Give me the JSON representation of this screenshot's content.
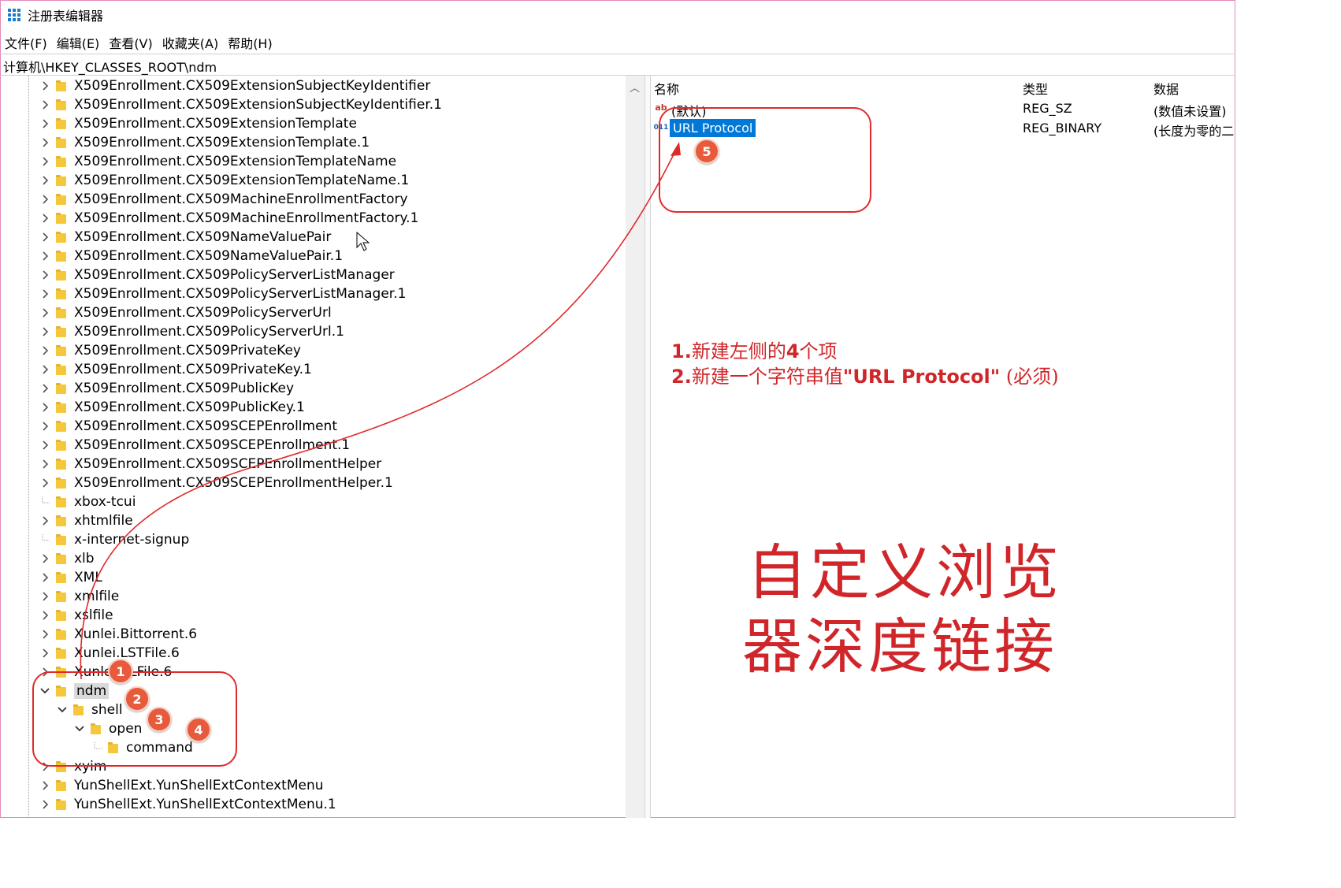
{
  "window": {
    "title": "注册表编辑器"
  },
  "menu": [
    "文件(F)",
    "编辑(E)",
    "查看(V)",
    "收藏夹(A)",
    "帮助(H)"
  ],
  "address": "计算机\\HKEY_CLASSES_ROOT\\ndm",
  "tree": {
    "items": [
      {
        "label": "X509Enrollment.CX509ExtensionSubjectKeyIdentifier",
        "expander": "collapsed"
      },
      {
        "label": "X509Enrollment.CX509ExtensionSubjectKeyIdentifier.1",
        "expander": "collapsed"
      },
      {
        "label": "X509Enrollment.CX509ExtensionTemplate",
        "expander": "collapsed"
      },
      {
        "label": "X509Enrollment.CX509ExtensionTemplate.1",
        "expander": "collapsed"
      },
      {
        "label": "X509Enrollment.CX509ExtensionTemplateName",
        "expander": "collapsed"
      },
      {
        "label": "X509Enrollment.CX509ExtensionTemplateName.1",
        "expander": "collapsed"
      },
      {
        "label": "X509Enrollment.CX509MachineEnrollmentFactory",
        "expander": "collapsed"
      },
      {
        "label": "X509Enrollment.CX509MachineEnrollmentFactory.1",
        "expander": "collapsed"
      },
      {
        "label": "X509Enrollment.CX509NameValuePair",
        "expander": "collapsed"
      },
      {
        "label": "X509Enrollment.CX509NameValuePair.1",
        "expander": "collapsed"
      },
      {
        "label": "X509Enrollment.CX509PolicyServerListManager",
        "expander": "collapsed"
      },
      {
        "label": "X509Enrollment.CX509PolicyServerListManager.1",
        "expander": "collapsed"
      },
      {
        "label": "X509Enrollment.CX509PolicyServerUrl",
        "expander": "collapsed"
      },
      {
        "label": "X509Enrollment.CX509PolicyServerUrl.1",
        "expander": "collapsed"
      },
      {
        "label": "X509Enrollment.CX509PrivateKey",
        "expander": "collapsed"
      },
      {
        "label": "X509Enrollment.CX509PrivateKey.1",
        "expander": "collapsed"
      },
      {
        "label": "X509Enrollment.CX509PublicKey",
        "expander": "collapsed"
      },
      {
        "label": "X509Enrollment.CX509PublicKey.1",
        "expander": "collapsed"
      },
      {
        "label": "X509Enrollment.CX509SCEPEnrollment",
        "expander": "collapsed"
      },
      {
        "label": "X509Enrollment.CX509SCEPEnrollment.1",
        "expander": "collapsed"
      },
      {
        "label": "X509Enrollment.CX509SCEPEnrollmentHelper",
        "expander": "collapsed"
      },
      {
        "label": "X509Enrollment.CX509SCEPEnrollmentHelper.1",
        "expander": "collapsed"
      },
      {
        "label": "xbox-tcui",
        "expander": "none"
      },
      {
        "label": "xhtmlfile",
        "expander": "collapsed"
      },
      {
        "label": "x-internet-signup",
        "expander": "none"
      },
      {
        "label": "xlb",
        "expander": "collapsed"
      },
      {
        "label": "XML",
        "expander": "collapsed"
      },
      {
        "label": "xmlfile",
        "expander": "collapsed"
      },
      {
        "label": "xslfile",
        "expander": "collapsed"
      },
      {
        "label": "Xunlei.Bittorrent.6",
        "expander": "collapsed"
      },
      {
        "label": "Xunlei.LSTFile.6",
        "expander": "collapsed"
      },
      {
        "label": "Xunlei.XLFile.6",
        "expander": "collapsed"
      },
      {
        "label": "ndm",
        "expander": "expanded"
      },
      {
        "label": "shell",
        "expander": "expanded"
      },
      {
        "label": "open",
        "expander": "expanded"
      },
      {
        "label": "command",
        "expander": "none"
      },
      {
        "label": "xyim",
        "expander": "collapsed"
      },
      {
        "label": "YunShellExt.YunShellExtContextMenu",
        "expander": "collapsed"
      },
      {
        "label": "YunShellExt.YunShellExtContextMenu.1",
        "expander": "collapsed"
      }
    ]
  },
  "values_list": {
    "headers": {
      "name": "名称",
      "type": "类型",
      "data": "数据"
    },
    "rows": [
      {
        "icon": "string-value-icon",
        "name": "(默认)",
        "type": "REG_SZ",
        "data": "(数值未设置)"
      },
      {
        "icon": "binary-value-icon",
        "name": "URL Protocol",
        "type": "REG_BINARY",
        "data": "(长度为零的二"
      }
    ]
  },
  "annotations": {
    "step_badges": [
      "1",
      "2",
      "3",
      "4",
      "5"
    ],
    "instructions": [
      {
        "num": "1.",
        "text": "新建左侧的",
        "bold": "4",
        "tail": "个项"
      },
      {
        "num": "2.",
        "text": "新建一个字符串值",
        "bold": "\"URL Protocol\"",
        "tail": " (必须)"
      }
    ],
    "headline_line1": "自定义浏览",
    "headline_line2": "器深度链接",
    "color": "#d0262a"
  },
  "colors": {
    "selection": "#0078d7",
    "folder": "#f5c83c",
    "frame": "#e08ab8"
  }
}
